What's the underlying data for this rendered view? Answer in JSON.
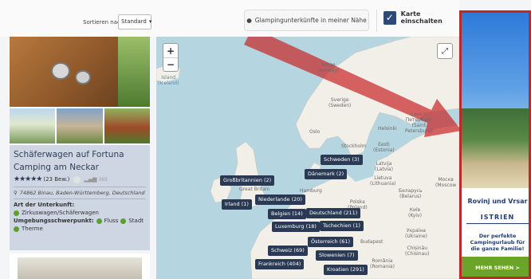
{
  "toolbar": {
    "sort_label": "Sortieren nach",
    "sort_value": "Standard",
    "nearby_label": "Glampingunterkünfte in meiner Nähe",
    "map_toggle_label": "Karte einschalten"
  },
  "listing": {
    "title": "Schäferwagen auf Fortuna Camping am Neckar",
    "review_count": "(23 Bew.)",
    "signal_value": "365",
    "address": "74862 Binau, Baden-Württemberg, Deutschland",
    "type_label": "Art der Unterkunft:",
    "type_value": "Zirkuswagen/Schäferwagen",
    "focus_label": "Umgebungsschwerpunkt:",
    "focus_items": [
      "Fluss",
      "Stadt",
      "Therme"
    ]
  },
  "map": {
    "zoom_in": "+",
    "zoom_out": "−",
    "labels": {
      "island": "Island\n(Iceland)",
      "norge": "Norge\n(Norway)",
      "sverige": "Sverige\n(Sweden)",
      "oslo": "Oslo",
      "helsinki": "Helsinki",
      "spb": "Санкт-\nПетербург\n(Saint\nPetersburg)",
      "stockholm": "Stockholm",
      "eesti": "Eesti\n(Estonia)",
      "latvija": "Latvija\n(Latvia)",
      "lietuva": "Lietuva\n(Lithuania)",
      "moscow": "Москв\n(Moscow",
      "belarus": "Беларусь\n(Belarus)",
      "great_britain": "Great Britain",
      "hamburg": "Hamburg",
      "polska": "Polska\n(Poland)",
      "kyiv": "Київ\n(Kyiv)",
      "budapest": "Budapest",
      "ukraine": "Україна\n(Ukraine)",
      "chisinau": "Chișinău\n(Chisinau)",
      "romania": "România\n(Romania)"
    },
    "pins": {
      "schweden": "Schweden (3)",
      "daenemark": "Dänemark (2)",
      "grossbritannien": "Großbritannien (2)",
      "irland": "Irland (1)",
      "niederlande": "Niederlande (20)",
      "belgien": "Belgien (14)",
      "deutschland": "Deutschland (211)",
      "luxemburg": "Luxemburg (18)",
      "tschechien": "Tschechien (1)",
      "oesterreich": "Österreich (61)",
      "schweiz": "Schweiz (69)",
      "slowenien": "Slowenien (7)",
      "frankreich": "Frankreich (404)",
      "kroatien": "Kroatien (291)"
    }
  },
  "ad": {
    "headline": "Rovinj und Vrsar",
    "region": "ISTRIEN",
    "body": "Der perfekte Campingurlaub für die ganze Familie!",
    "cta": "MEHR SEHEN >"
  }
}
